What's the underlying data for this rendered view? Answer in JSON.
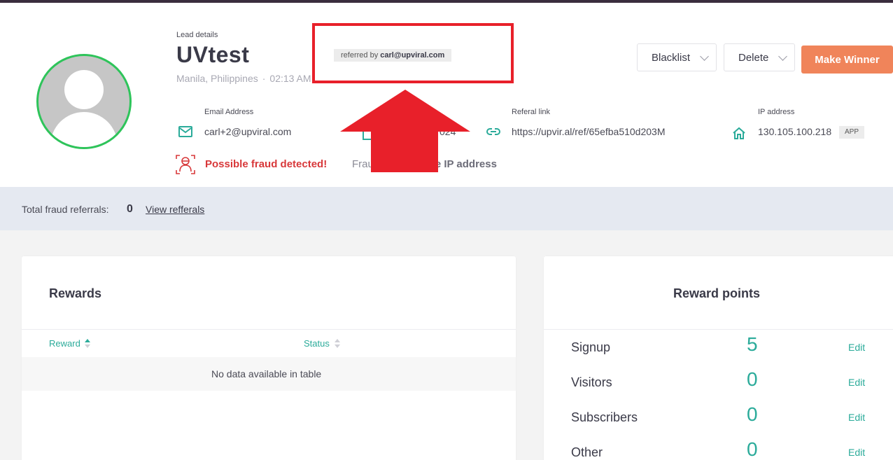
{
  "lead": {
    "section_label": "Lead details",
    "name": "UVtest",
    "location": "Manila, Philippines",
    "separator": "·",
    "time": "02:13 AM",
    "referred_prefix": "referred by",
    "referred_by": "carl@upviral.com"
  },
  "actions": {
    "blacklist": "Blacklist",
    "delete": "Delete",
    "make_winner": "Make Winner"
  },
  "fields": {
    "email_label": "Email Address",
    "email_value": "carl+2@upviral.com",
    "date_value_partial": "024",
    "referral_label": "Referal link",
    "referral_value": "https://upvir.al/ref/65efba510d203M",
    "ip_label": "IP address",
    "ip_value": "130.105.100.218",
    "ip_badge": "APP"
  },
  "fraud": {
    "warning": "Possible fraud detected!",
    "reason_prefix": "Frau",
    "reason_bold": "e IP address",
    "total_label": "Total fraud referrals:",
    "total_value": "0",
    "view_link": "View refferals"
  },
  "rewards": {
    "title": "Rewards",
    "columns": [
      "Reward",
      "Status"
    ],
    "empty_message": "No data available in table"
  },
  "reward_points": {
    "title": "Reward points",
    "edit_label": "Edit",
    "rows": [
      {
        "name": "Signup",
        "value": "5"
      },
      {
        "name": "Visitors",
        "value": "0"
      },
      {
        "name": "Subscribers",
        "value": "0"
      },
      {
        "name": "Other",
        "value": "0"
      }
    ]
  },
  "colors": {
    "accent_teal": "#2bab9a",
    "winner_orange": "#f0845a",
    "fraud_red": "#d8383a",
    "avatar_ring": "#2ec45a",
    "highlight_red": "#e8202a"
  }
}
